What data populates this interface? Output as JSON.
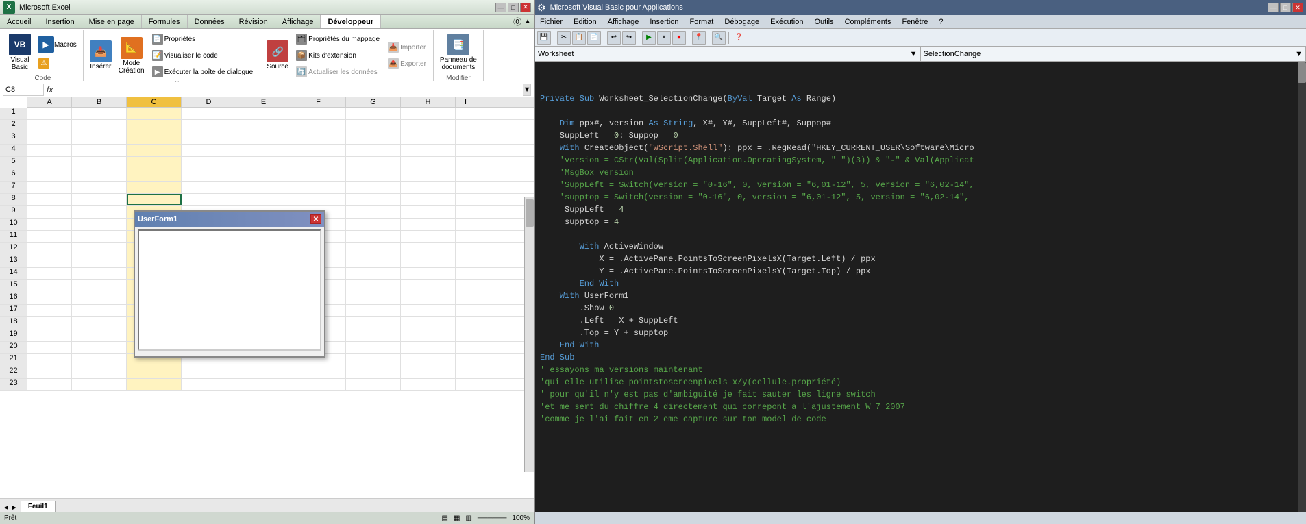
{
  "excel": {
    "titlebar": {
      "logo": "X",
      "text": "Microsoft Excel",
      "min_btn": "—",
      "max_btn": "□",
      "close_btn": "✕"
    },
    "ribbon": {
      "tabs": [
        {
          "label": "Accueil",
          "active": false
        },
        {
          "label": "Insertion",
          "active": false
        },
        {
          "label": "Mise en page",
          "active": false
        },
        {
          "label": "Formules",
          "active": false
        },
        {
          "label": "Données",
          "active": false
        },
        {
          "label": "Révision",
          "active": false
        },
        {
          "label": "Affichage",
          "active": false
        },
        {
          "label": "Développeur",
          "active": true
        }
      ],
      "groups": {
        "code": {
          "label": "Code",
          "btns": [
            {
              "label": "Visual\nBasic",
              "icon": "📋"
            },
            {
              "label": "Macros",
              "icon": "▶"
            },
            {
              "label": "⚠",
              "small": true
            }
          ]
        },
        "controles": {
          "label": "Contrôles",
          "btns_large": [
            {
              "label": "Insérer",
              "icon": "📥"
            },
            {
              "label": "Mode\nCréation",
              "icon": "📐"
            }
          ],
          "btns_small": [
            {
              "label": "Propriétés",
              "icon": "📄"
            },
            {
              "label": "Visualiser le code",
              "icon": "📝"
            },
            {
              "label": "Exécuter la boîte de dialogue",
              "icon": "▶"
            }
          ]
        },
        "xml_group": {
          "label": "XML",
          "btns_small": [
            {
              "label": "Propriétés du mappage",
              "icon": "🗂"
            },
            {
              "label": "Kits d'extension",
              "icon": "📦"
            },
            {
              "label": "Actualiser les données",
              "icon": "🔄"
            },
            {
              "label": "Importer",
              "icon": "📥"
            },
            {
              "label": "Exporter",
              "icon": "📤"
            }
          ]
        },
        "source": {
          "label": "",
          "btn_large": {
            "label": "Source",
            "icon": "🔗"
          }
        },
        "modifier": {
          "label": "Modifier",
          "btn_large": {
            "label": "Panneau de\ndocuments",
            "icon": "📑"
          }
        }
      }
    },
    "formula_bar": {
      "cell_ref": "C8",
      "fx_label": "fx"
    },
    "columns": [
      "A",
      "B",
      "C",
      "D",
      "E",
      "F",
      "G",
      "H",
      "I"
    ],
    "rows": [
      "1",
      "2",
      "3",
      "4",
      "5",
      "6",
      "7",
      "8",
      "9",
      "10",
      "11",
      "12",
      "13",
      "14",
      "15",
      "16",
      "17",
      "18",
      "19",
      "20",
      "21",
      "22",
      "23"
    ],
    "active_cell": "C8",
    "sheet_tabs": [
      {
        "label": "Feuil1",
        "active": true
      }
    ],
    "statusbar": {
      "text": "Prêt"
    }
  },
  "userform": {
    "title": "UserForm1",
    "close_btn": "✕"
  },
  "vba": {
    "titlebar": {
      "text": "Microsoft Visual Basic pour Applications",
      "min_btn": "—",
      "max_btn": "□",
      "close_btn": "✕"
    },
    "menu": {
      "items": [
        "Fichier",
        "Edition",
        "Affichage",
        "Insertion",
        "Format",
        "Débogage",
        "Exécution",
        "Outils",
        "Compléments",
        "Fenêtre",
        "?"
      ]
    },
    "toolbar": {
      "btns": [
        "💾",
        "✂",
        "📋",
        "📄",
        "↩",
        "↪",
        "▶",
        "⏸",
        "⏹",
        "📍",
        "🔍"
      ]
    },
    "selectors": {
      "object": "Worksheet",
      "procedure": "SelectionChange"
    },
    "code": {
      "lines": [
        "Private Sub Worksheet_SelectionChange(ByVal Target As Range)",
        "",
        "    Dim ppx#, version As String, X#, Y#, SuppLeft#, Suppop#",
        "    SuppLeft = 0: Suppop = 0",
        "    With CreateObject(\"WScript.Shell\"): ppx = .RegRead(\"HKEY_CURRENT_USER\\Software\\Micro",
        "    'version = CStr(Val(Split(Application.OperatingSystem, \" \")(3)) & \"-\" & Val(Applicat",
        "    'MsgBox version",
        "    'SuppLeft = Switch(version = \"0-16\", 0, version = \"6,01-12\", 5, version = \"6,02-14\",",
        "    'supptop = Switch(version = \"0-16\", 0, version = \"6,01-12\", 5, version = \"6,02-14\",",
        "     SuppLeft = 4",
        "     supptop = 4",
        "",
        "        With ActiveWindow",
        "            X = .ActivePane.PointsToScreenPixelsX(Target.Left) / ppx",
        "            Y = .ActivePane.PointsToScreenPixelsY(Target.Top) / ppx",
        "        End With",
        "    With UserForm1",
        "        .Show 0",
        "        .Left = X + SuppLeft",
        "        .Top = Y + supptop",
        "    End With",
        "End Sub",
        "' essayons ma versions maintenant",
        "'qui elle utilise pointstoscreenpixels x/y(cellule.propriété)",
        "' pour qu'il n'y est pas d'ambiguité je fait sauter les ligne switch",
        "'et me sert du chiffre 4 directement qui correpont a l'ajustement W 7 2007",
        "'comme je l'ai fait en 2 eme capture sur ton model de code"
      ]
    },
    "statusbar": {
      "text": ""
    }
  },
  "splitter": {}
}
